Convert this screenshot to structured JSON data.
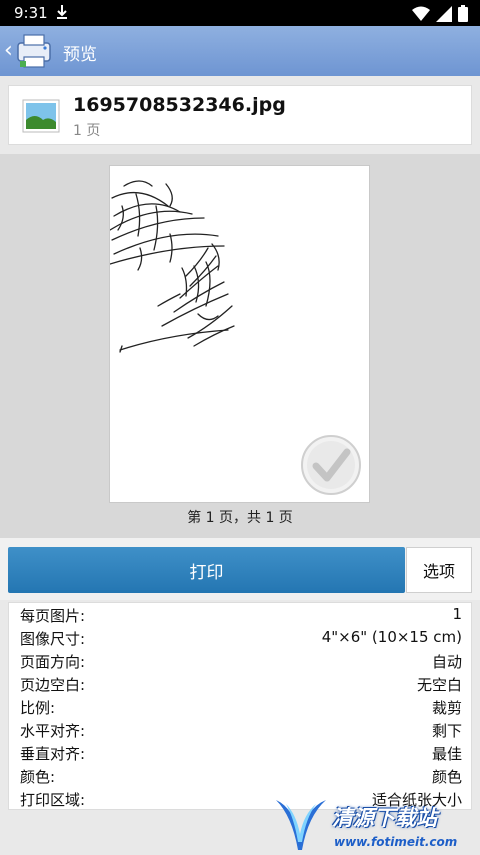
{
  "status": {
    "time": "9:31"
  },
  "app_bar": {
    "title": "预览"
  },
  "file": {
    "name": "1695708532346.jpg",
    "pages": "1 页"
  },
  "preview": {
    "page_indicator": "第 1 页，共 1 页"
  },
  "actions": {
    "print_label": "打印",
    "options_label": "选项"
  },
  "settings": [
    {
      "label": "每页图片:",
      "value": "1"
    },
    {
      "label": "图像尺寸:",
      "value": "4\"×6\" (10×15 cm)"
    },
    {
      "label": "页面方向:",
      "value": "自动"
    },
    {
      "label": "页边空白:",
      "value": "无空白"
    },
    {
      "label": "比例:",
      "value": "裁剪"
    },
    {
      "label": "水平对齐:",
      "value": "剩下"
    },
    {
      "label": "垂直对齐:",
      "value": "最佳"
    },
    {
      "label": "颜色:",
      "value": "颜色"
    },
    {
      "label": "打印区域:",
      "value": "适合纸张大小"
    }
  ],
  "watermark": {
    "text": "清源下载站",
    "url": "www.fotimeit.com"
  },
  "icons": [
    "download-icon",
    "wifi-icon",
    "signal-icon",
    "battery-icon",
    "back-chevron-icon",
    "printer-logo-icon",
    "image-thumbnail-icon",
    "checkmark-icon"
  ]
}
